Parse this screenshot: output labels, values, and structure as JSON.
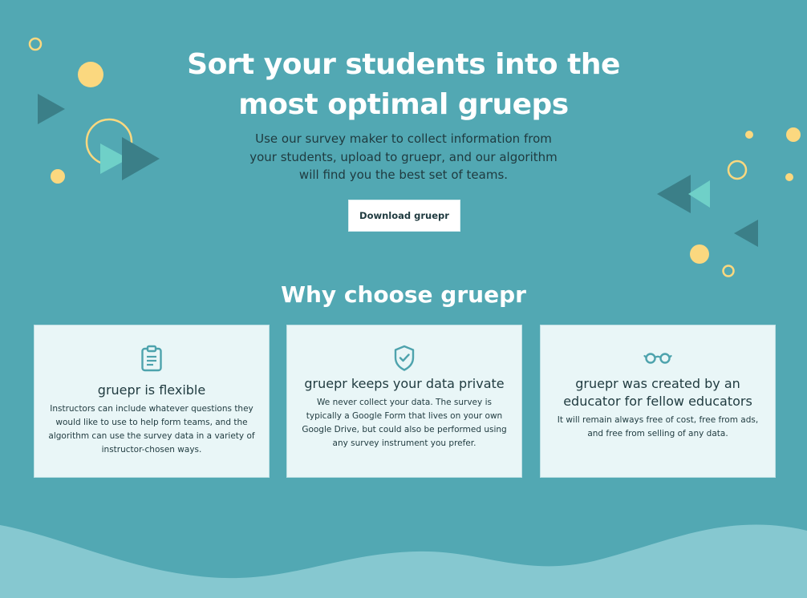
{
  "hero": {
    "title_line1": "Sort your students into the",
    "title_line2": "most optimal grueps",
    "subtitle": "Use our survey maker to collect information from your students, upload to gruepr, and our algorithm will find you the best set of teams.",
    "download_label": "Download gruepr"
  },
  "why": {
    "title": "Why choose gruepr",
    "cards": [
      {
        "icon": "clipboard-icon",
        "title": "gruepr is flexible",
        "body": "Instructors can include whatever questions they would like to use to help form teams, and the algorithm can use the survey data in a variety of instructor-chosen ways."
      },
      {
        "icon": "shield-check-icon",
        "title": "gruepr keeps your data private",
        "body": "We never collect your data. The survey is typically a Google Form that lives on your own Google Drive, but could also be performed using any survey instrument you prefer."
      },
      {
        "icon": "glasses-icon",
        "title": "gruepr was created by an educator for fellow educators",
        "body": "It will remain always free of cost, free from ads, and free from selling of any data."
      }
    ]
  },
  "colors": {
    "background": "#52a8b3",
    "card_bg": "#e9f6f7",
    "accent_yellow": "#fbd87f",
    "triangle_dark": "#3b7f88",
    "triangle_light": "#6fd0c8",
    "wave": "#86c8d0",
    "icon_teal": "#4ea3ad"
  }
}
